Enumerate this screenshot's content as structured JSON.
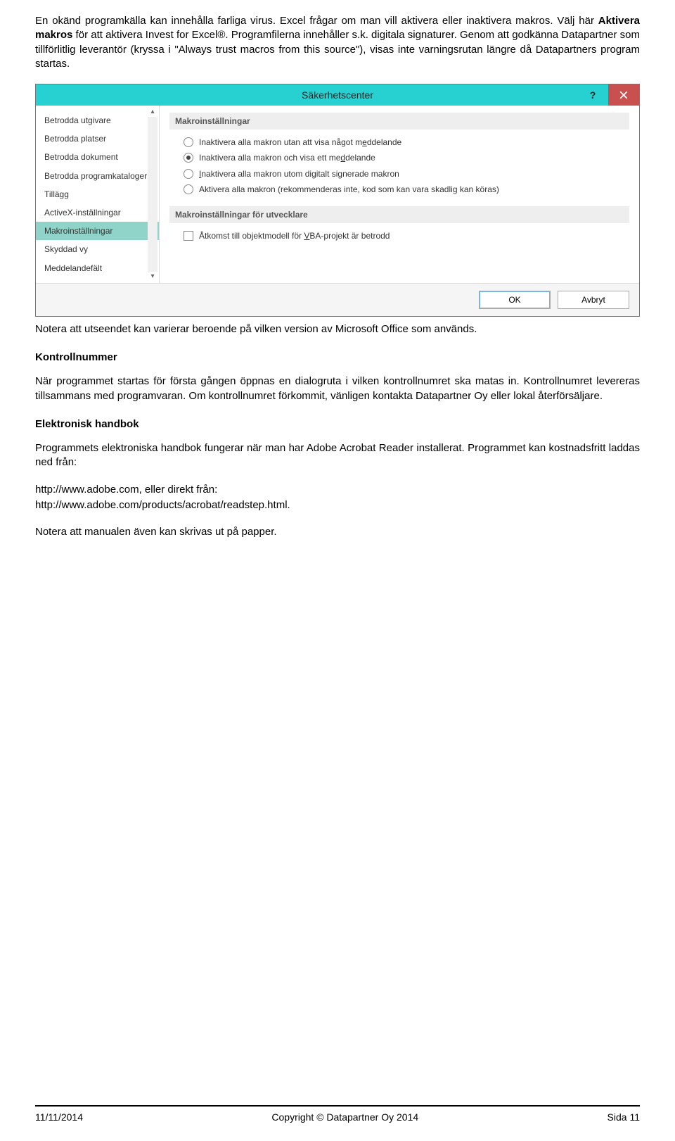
{
  "intro": {
    "p1_a": "En okänd programkälla kan innehålla farliga virus. Excel frågar om man vill aktivera eller inaktivera makros. Välj här ",
    "p1_bold": "Aktivera makros",
    "p1_b": " för att aktivera Invest for Excel®. Programfilerna innehåller s.k. digitala signaturer. Genom att godkänna Datapartner som tillförlitlig leverantör (kryssa i \"Always trust macros from this source\"), visas inte varningsrutan längre då Datapartners program startas."
  },
  "dialog": {
    "title": "Säkerhetscenter",
    "nav": [
      "Betrodda utgivare",
      "Betrodda platser",
      "Betrodda dokument",
      "Betrodda programkataloger",
      "Tillägg",
      "ActiveX-inställningar",
      "Makroinställningar",
      "Skyddad vy",
      "Meddelandefält"
    ],
    "selected_index": 6,
    "group1_title": "Makroinställningar",
    "radios": [
      {
        "label_a": "Inaktivera alla makron utan att visa något m",
        "u": "e",
        "label_b": "ddelande",
        "checked": false
      },
      {
        "label_a": "Inaktivera alla makron och visa ett me",
        "u": "d",
        "label_b": "delande",
        "checked": true
      },
      {
        "label_a": "",
        "u": "I",
        "label_b": "naktivera alla makron utom digitalt signerade makron",
        "checked": false
      },
      {
        "label_a": "Aktivera alla makron (rekommenderas inte, kod som kan vara skadli",
        "u": "g",
        "label_b": " kan köras)",
        "checked": false
      }
    ],
    "group2_title": "Makroinställningar för utvecklare",
    "checkbox": {
      "label_a": "Åtkomst till objektmodell för ",
      "u": "V",
      "label_b": "BA-projekt är betrodd"
    },
    "ok": "OK",
    "cancel": "Avbryt",
    "help": "?"
  },
  "after_dialog": "Notera att utseendet kan varierar beroende på vilken version av Microsoft Office som används.",
  "kontrollnummer": {
    "heading": "Kontrollnummer",
    "p": "När programmet startas för första gången öppnas en dialogruta i vilken kontrollnumret ska matas in. Kontrollnumret levereras tillsammans med programvaran. Om kontrollnumret förkommit, vänligen kontakta Datapartner Oy eller lokal återförsäljare."
  },
  "handbok": {
    "heading": "Elektronisk handbok",
    "p1": "Programmets elektroniska handbok fungerar när man har Adobe Acrobat Reader installerat. Programmet kan kostnadsfritt laddas ned från:",
    "link1_a": "http://www.adobe.com",
    "link1_b": ", eller direkt från:",
    "link2": "http://www.adobe.com/products/acrobat/readstep.html",
    "p3": "Notera att manualen även kan skrivas ut på papper."
  },
  "footer": {
    "left": "11/11/2014",
    "center": "Copyright © Datapartner Oy 2014",
    "right": "Sida 11"
  }
}
